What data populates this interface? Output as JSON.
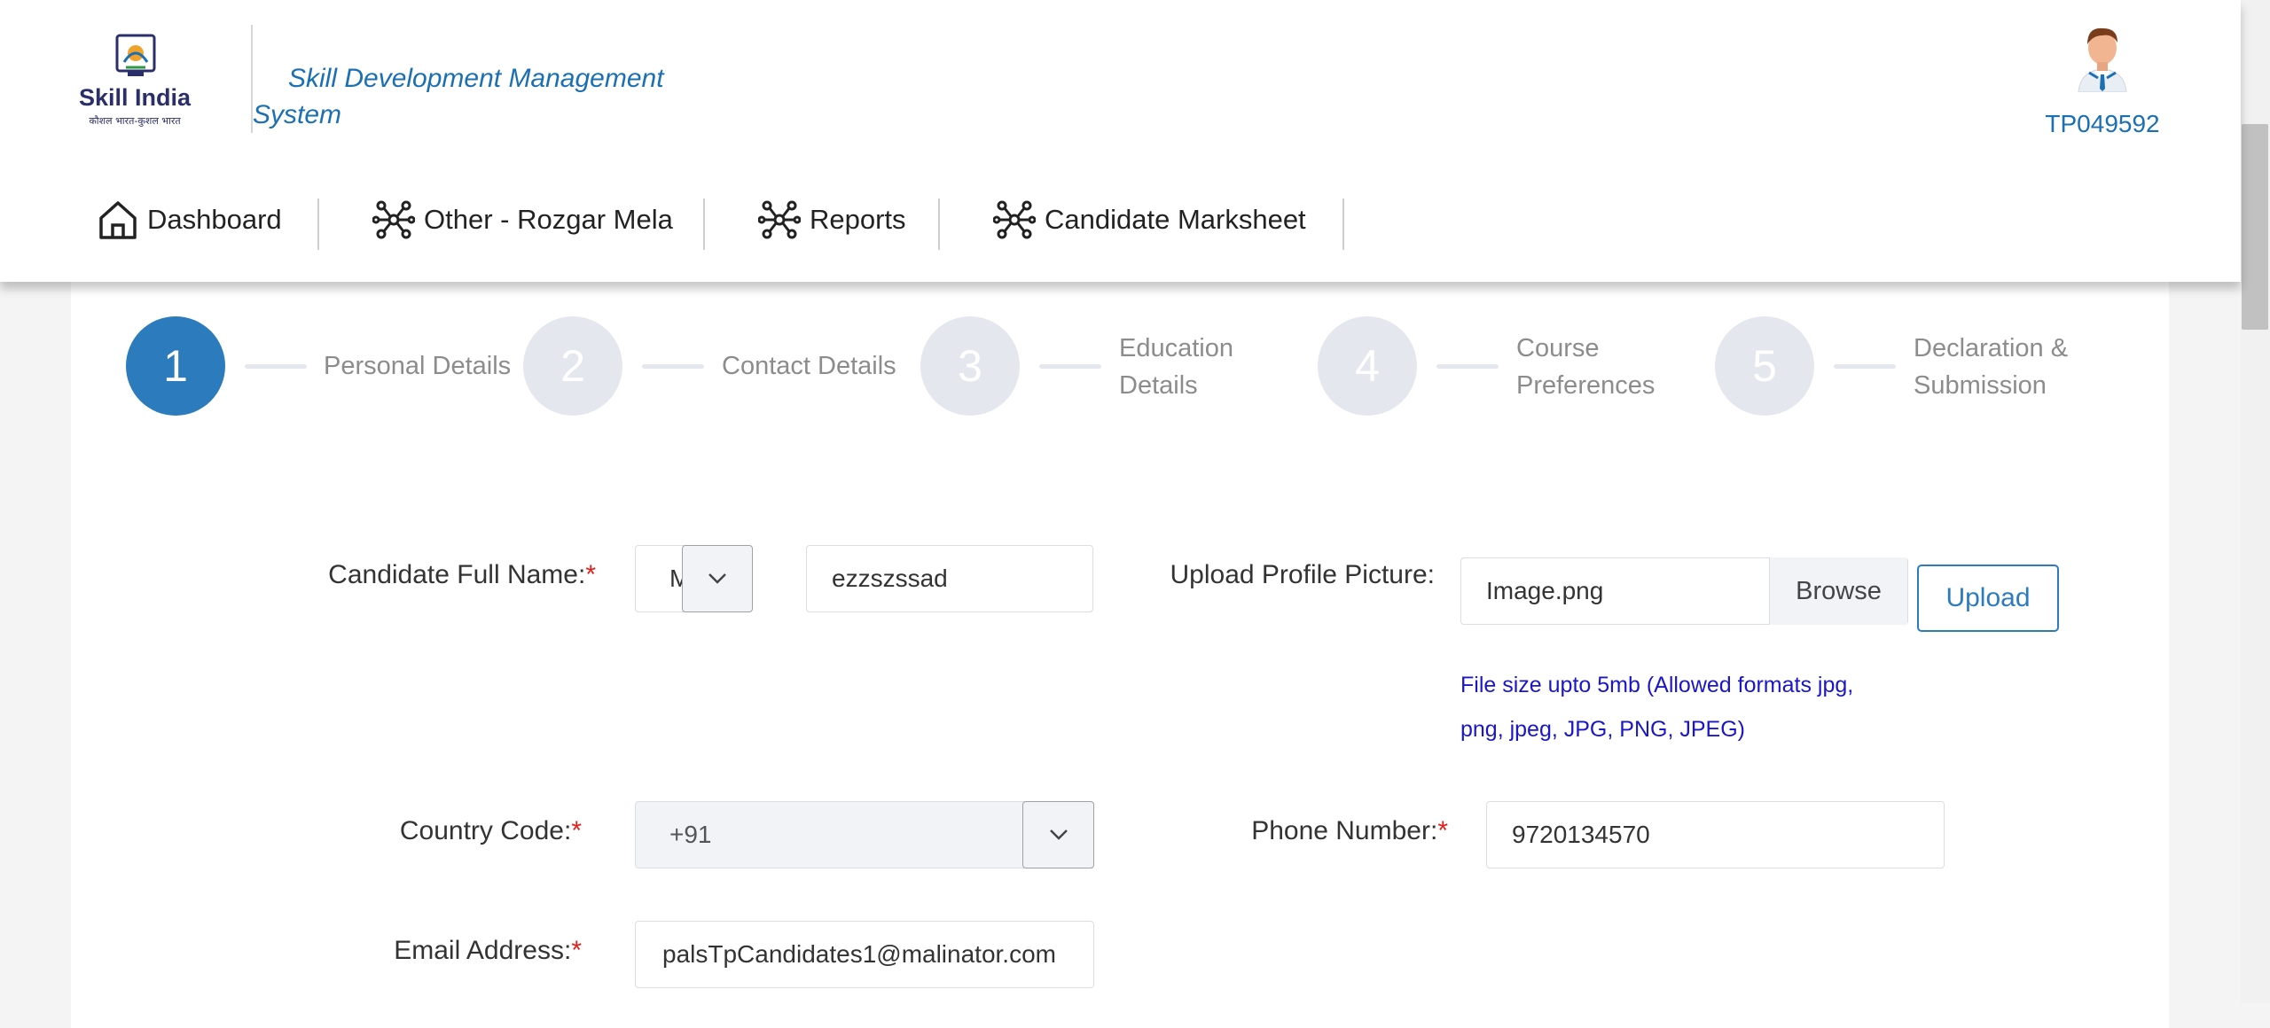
{
  "header": {
    "logo_title": "Skill India",
    "logo_tagline": "कौशल भारत-कुशल भारत",
    "system_title": "Skill Development Management System",
    "user_id": "TP049592"
  },
  "nav": {
    "items": [
      {
        "label": "Dashboard",
        "icon": "home-icon"
      },
      {
        "label": "Other - Rozgar Mela",
        "icon": "network-icon"
      },
      {
        "label": "Reports",
        "icon": "network-icon"
      },
      {
        "label": "Candidate Marksheet",
        "icon": "network-icon"
      }
    ]
  },
  "stepper": {
    "active": 1,
    "steps": [
      {
        "number": "1",
        "line1": "Personal Details",
        "line2": ""
      },
      {
        "number": "2",
        "line1": "Contact Details",
        "line2": ""
      },
      {
        "number": "3",
        "line1": "Education",
        "line2": "Details"
      },
      {
        "number": "4",
        "line1": "Course",
        "line2": "Preferences"
      },
      {
        "number": "5",
        "line1": "Declaration &",
        "line2": "Submission"
      }
    ]
  },
  "form": {
    "full_name_label": "Candidate Full Name:",
    "salutation_value": "M",
    "full_name_value": "ezzszssad",
    "upload_label": "Upload Profile Picture:",
    "file_name": "Image.png",
    "browse_label": "Browse",
    "upload_button": "Upload",
    "file_hint_line1": "File size upto 5mb (Allowed formats jpg,",
    "file_hint_line2": "png, jpeg, JPG, PNG, JPEG)",
    "country_code_label": "Country Code:",
    "country_code_value": "+91",
    "phone_label": "Phone Number:",
    "phone_value": "9720134570",
    "email_label": "Email Address:",
    "email_value": "palsTpCandidates1@malinator.com",
    "required_mark": "*"
  },
  "colors": {
    "accent": "#2b7bbd",
    "title_blue": "#1b6fb3",
    "required": "#e0201b",
    "hint": "#1a16c9"
  }
}
